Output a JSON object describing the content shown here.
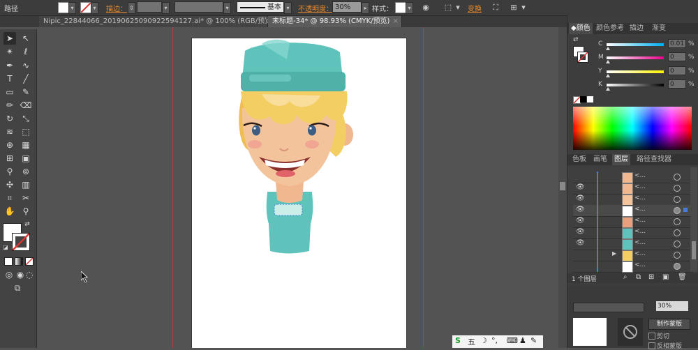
{
  "control_bar": {
    "title": "路径",
    "stroke_label": "描边：",
    "stroke_profile": "基本",
    "opacity_label": "不透明度：",
    "opacity_value": "30%",
    "style_label": "样式：",
    "transform_label": "变换"
  },
  "tabs": [
    {
      "label": "Nipic_22844066_20190625090922594127.ai* @ 100% (RGB/预览)",
      "close": "×"
    },
    {
      "label": "未标题-34* @ 98.93% (CMYK/预览)",
      "close": "×"
    }
  ],
  "color_panel": {
    "tabs": [
      "颜色",
      "颜色参考",
      "描边",
      "渐变"
    ],
    "channels": [
      {
        "letter": "C",
        "value": "0.01"
      },
      {
        "letter": "M",
        "value": "0"
      },
      {
        "letter": "Y",
        "value": "0"
      },
      {
        "letter": "K",
        "value": "0"
      }
    ],
    "unit": "%"
  },
  "layers_panel": {
    "tabs": [
      "色板",
      "画笔",
      "图层",
      "路径查找器"
    ],
    "row_label": "<...",
    "status": "1 个图层"
  },
  "transparency_panel": {
    "opacity": "30%",
    "make_mask": "制作蒙版",
    "clip": "剪切",
    "invert": "反相蒙版"
  },
  "taskbar": {
    "ime": "五"
  },
  "colors": {
    "accent_orange": "#e8892b",
    "guide_red": "#b93b3b",
    "layer_blue": "#4a7bd8",
    "hat_teal": "#5ec4bb",
    "hair_blonde": "#f3cf63"
  }
}
